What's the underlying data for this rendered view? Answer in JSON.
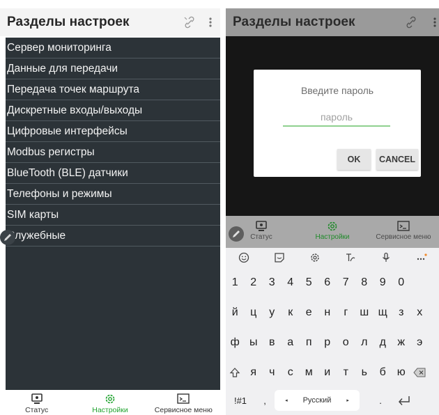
{
  "left": {
    "header_title": "Разделы настроек",
    "menu_items": [
      "Сервер мониторинга",
      "Данные для передачи",
      "Передача точек маршрута",
      "Дискретные входы/выходы",
      "Цифровые интерфейсы",
      "Modbus регистры",
      "BlueTooth (BLE) датчики",
      "Телефоны и режимы",
      "SIM карты",
      "Служебные"
    ],
    "nav": [
      {
        "label": "Статус",
        "icon": "monitor-icon"
      },
      {
        "label": "Настройки",
        "icon": "gear-icon",
        "active": true
      },
      {
        "label": "Сервисное меню",
        "icon": "terminal-icon"
      }
    ]
  },
  "right": {
    "header_title": "Разделы настроек",
    "dialog": {
      "title": "Введите пароль",
      "placeholder": "пароль",
      "ok_label": "OK",
      "cancel_label": "CANCEL"
    },
    "nav": [
      {
        "label": "Статус",
        "icon": "monitor-icon"
      },
      {
        "label": "Настройки",
        "icon": "gear-icon",
        "active": true
      },
      {
        "label": "Сервисное меню",
        "icon": "terminal-icon"
      }
    ],
    "keyboard": {
      "toolbar": [
        "emoji-icon",
        "sticker-icon",
        "settings-icon",
        "handwriting-icon",
        "mic-icon",
        "more-icon"
      ],
      "numbers": [
        "1",
        "2",
        "3",
        "4",
        "5",
        "6",
        "7",
        "8",
        "9",
        "0"
      ],
      "row1": [
        "й",
        "ц",
        "у",
        "к",
        "е",
        "н",
        "г",
        "ш",
        "щ",
        "з",
        "х"
      ],
      "row2": [
        "ф",
        "ы",
        "в",
        "а",
        "п",
        "р",
        "о",
        "л",
        "д",
        "ж",
        "э"
      ],
      "row3": [
        "я",
        "ч",
        "с",
        "м",
        "и",
        "т",
        "ь",
        "б",
        "ю"
      ],
      "symbols_label": "!#1",
      "comma": ",",
      "space_label": "Русский",
      "period": "."
    }
  },
  "colors": {
    "accent_green": "#1fa32e",
    "menu_background": "#2c3338",
    "divider": "#515a60"
  }
}
